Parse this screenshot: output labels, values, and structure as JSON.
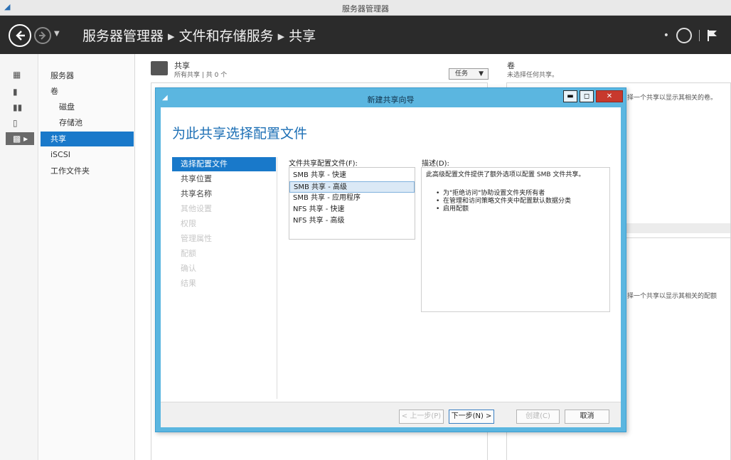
{
  "app": {
    "title": "服务器管理器"
  },
  "header": {
    "breadcrumb": [
      "服务器管理器",
      "文件和存储服务",
      "共享"
    ],
    "separator": "▸"
  },
  "nav": {
    "items": [
      {
        "label": "服务器"
      },
      {
        "label": "卷"
      },
      {
        "label": "磁盘"
      },
      {
        "label": "存储池"
      },
      {
        "label": "共享"
      },
      {
        "label": "iSCSI"
      },
      {
        "label": "工作文件夹"
      }
    ]
  },
  "background": {
    "share_title": "共享",
    "share_sub": "所有共享 | 共 0 个",
    "task_label": "任务",
    "volume_title": "卷",
    "volume_sub": "未选择任何共享。",
    "hint_1": "择一个共享以显示其相关的卷。",
    "hint_2": "择一个共享以显示其相关的配额"
  },
  "dialog": {
    "title": "新建共享向导",
    "heading": "为此共享选择配置文件",
    "steps": [
      {
        "label": "选择配置文件",
        "state": "active"
      },
      {
        "label": "共享位置",
        "state": "normal"
      },
      {
        "label": "共享名称",
        "state": "normal"
      },
      {
        "label": "其他设置",
        "state": "disabled"
      },
      {
        "label": "权限",
        "state": "disabled"
      },
      {
        "label": "管理属性",
        "state": "disabled"
      },
      {
        "label": "配额",
        "state": "disabled"
      },
      {
        "label": "确认",
        "state": "disabled"
      },
      {
        "label": "结果",
        "state": "disabled"
      }
    ],
    "profile_label": "文件共享配置文件(F):",
    "profiles": [
      {
        "label": "SMB 共享 - 快速",
        "selected": false
      },
      {
        "label": "SMB 共享 - 高级",
        "selected": true
      },
      {
        "label": "SMB 共享 - 应用程序",
        "selected": false
      },
      {
        "label": "NFS 共享 - 快速",
        "selected": false
      },
      {
        "label": "NFS 共享 - 高级",
        "selected": false
      }
    ],
    "desc_label": "描述(D):",
    "desc_text": "此高级配置文件提供了额外选项以配置 SMB 文件共享。",
    "desc_bullets": [
      "为\"拒绝访问\"协助设置文件夹所有者",
      "在管理和访问策略文件夹中配置默认数据分类",
      "启用配额"
    ],
    "buttons": {
      "prev": "< 上一步(P)",
      "next": "下一步(N) >",
      "create": "创建(C)",
      "cancel": "取消"
    }
  }
}
